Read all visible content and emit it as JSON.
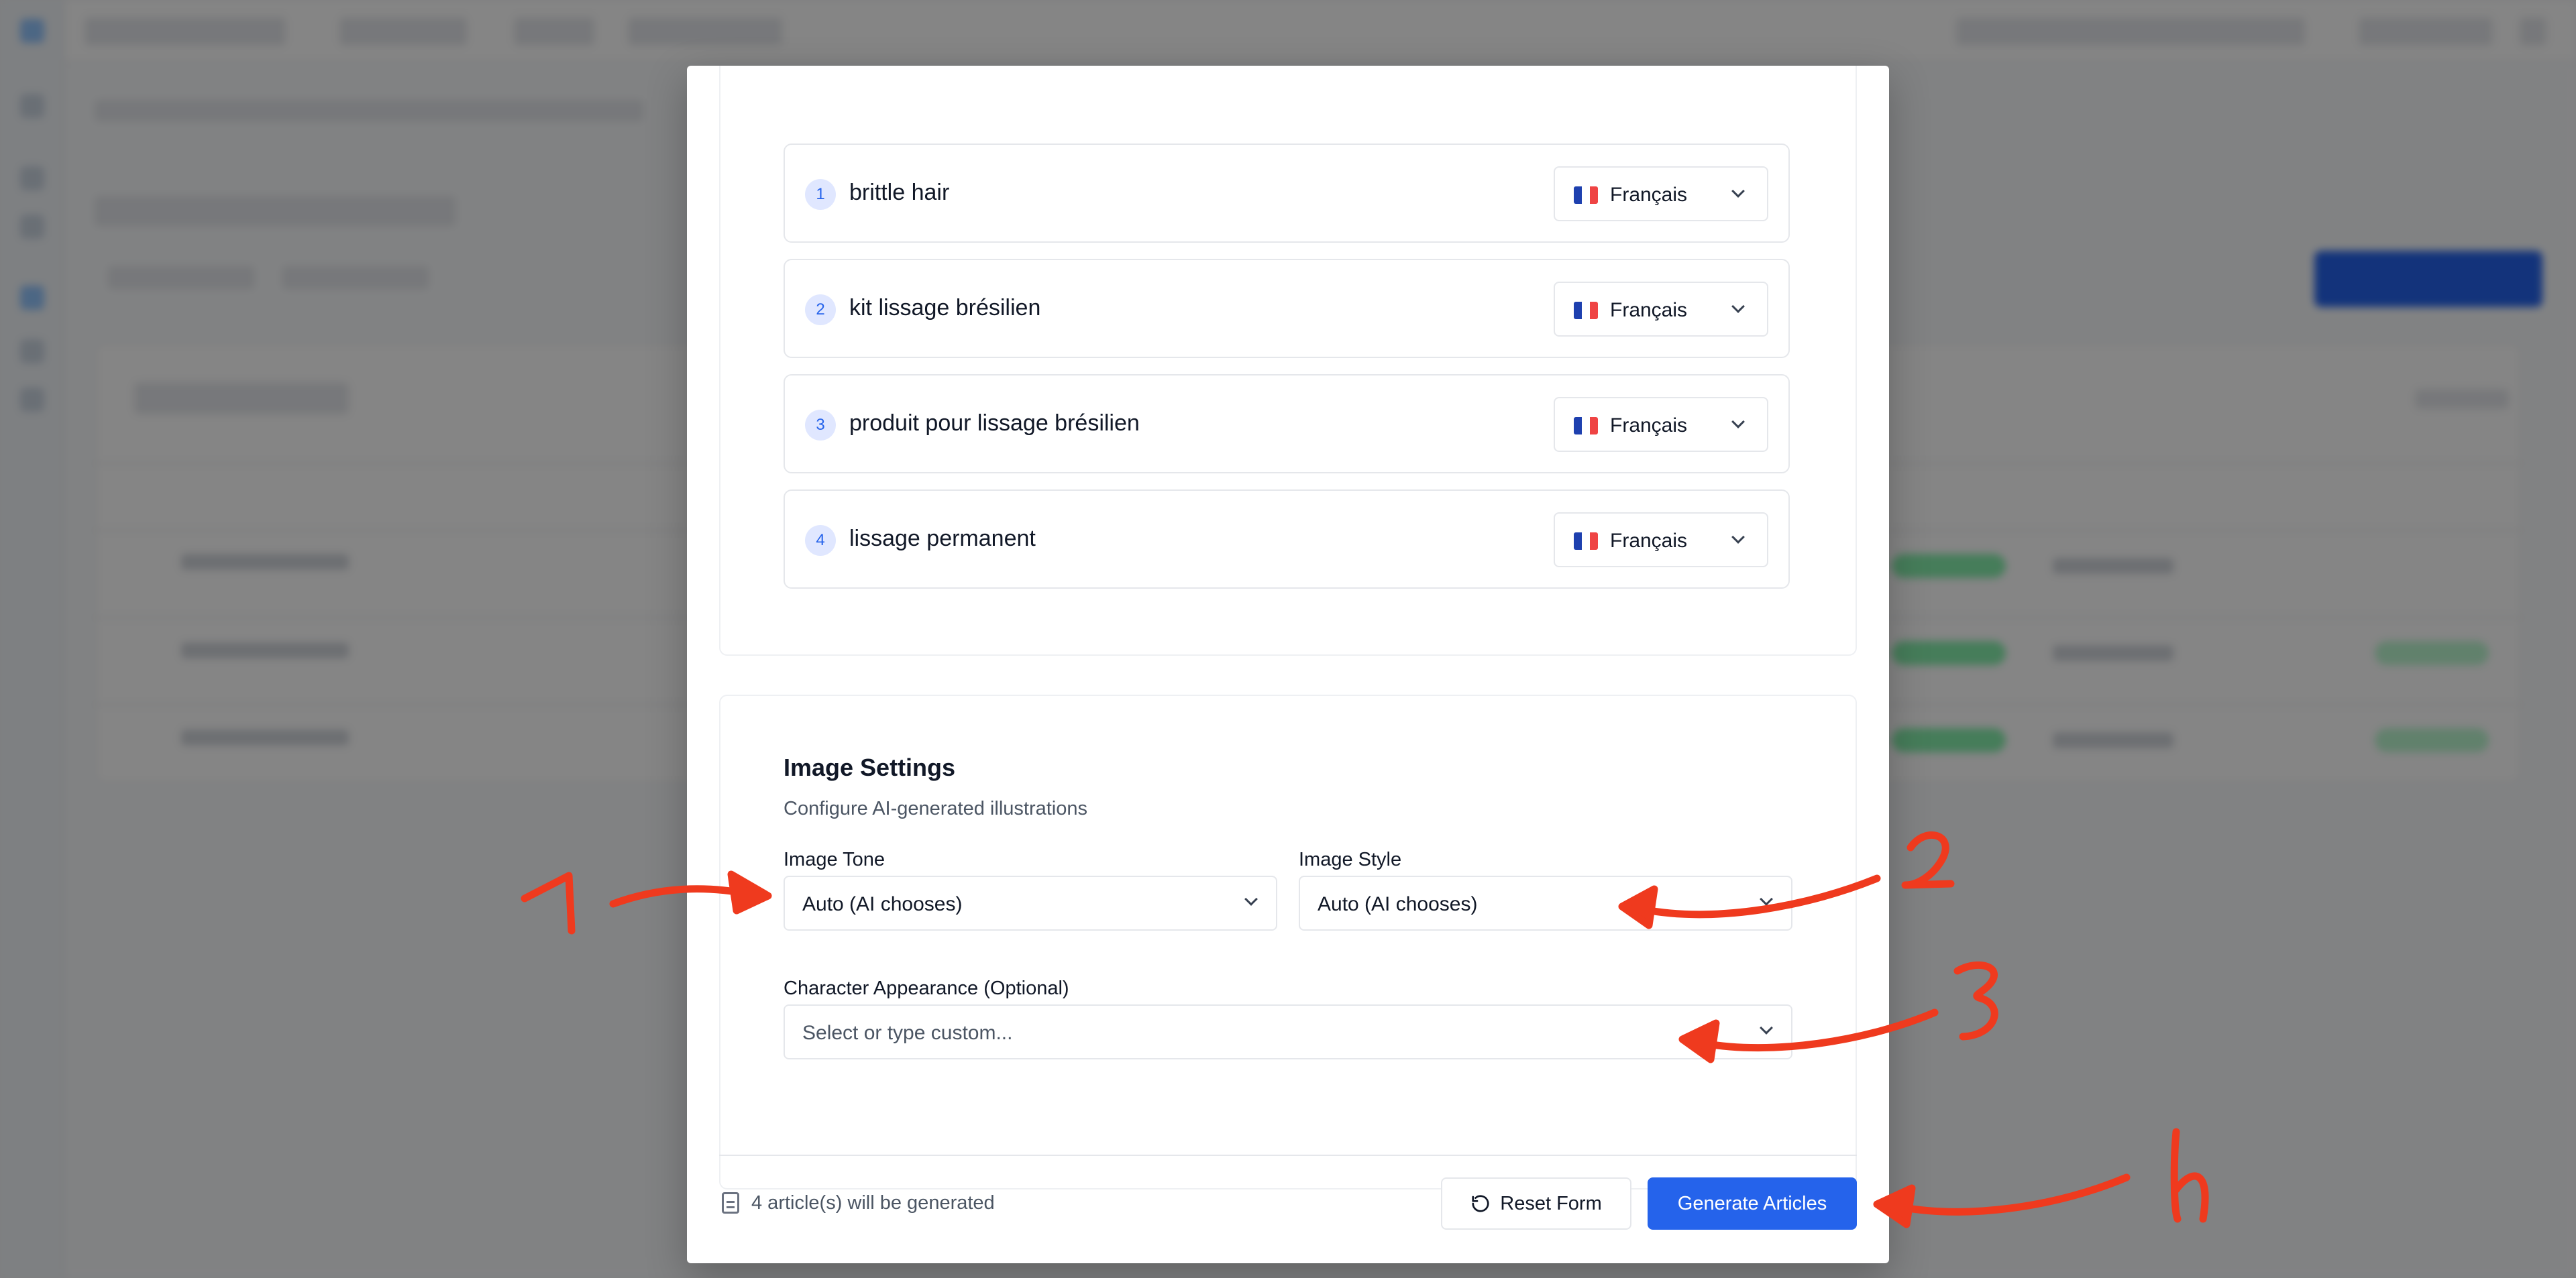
{
  "keywords": [
    {
      "num": "1",
      "text": "brittle hair",
      "language": "Français"
    },
    {
      "num": "2",
      "text": "kit lissage brésilien",
      "language": "Français"
    },
    {
      "num": "3",
      "text": "produit pour lissage brésilien",
      "language": "Français"
    },
    {
      "num": "4",
      "text": "lissage permanent",
      "language": "Français"
    }
  ],
  "image_settings": {
    "title": "Image Settings",
    "subtitle": "Configure AI-generated illustrations",
    "tone_label": "Image Tone",
    "tone_value": "Auto (AI chooses)",
    "style_label": "Image Style",
    "style_value": "Auto (AI chooses)",
    "character_label": "Character Appearance (Optional)",
    "character_placeholder": "Select or type custom..."
  },
  "footer": {
    "count_text": "4 article(s) will be generated",
    "reset_label": "Reset Form",
    "generate_label": "Generate Articles"
  },
  "annotations": [
    "1",
    "2",
    "3",
    "4"
  ],
  "colors": {
    "primary": "#2563eb",
    "annotation_red": "#ef3a1e",
    "overlay": "rgba(0,0,0,0.48)"
  }
}
